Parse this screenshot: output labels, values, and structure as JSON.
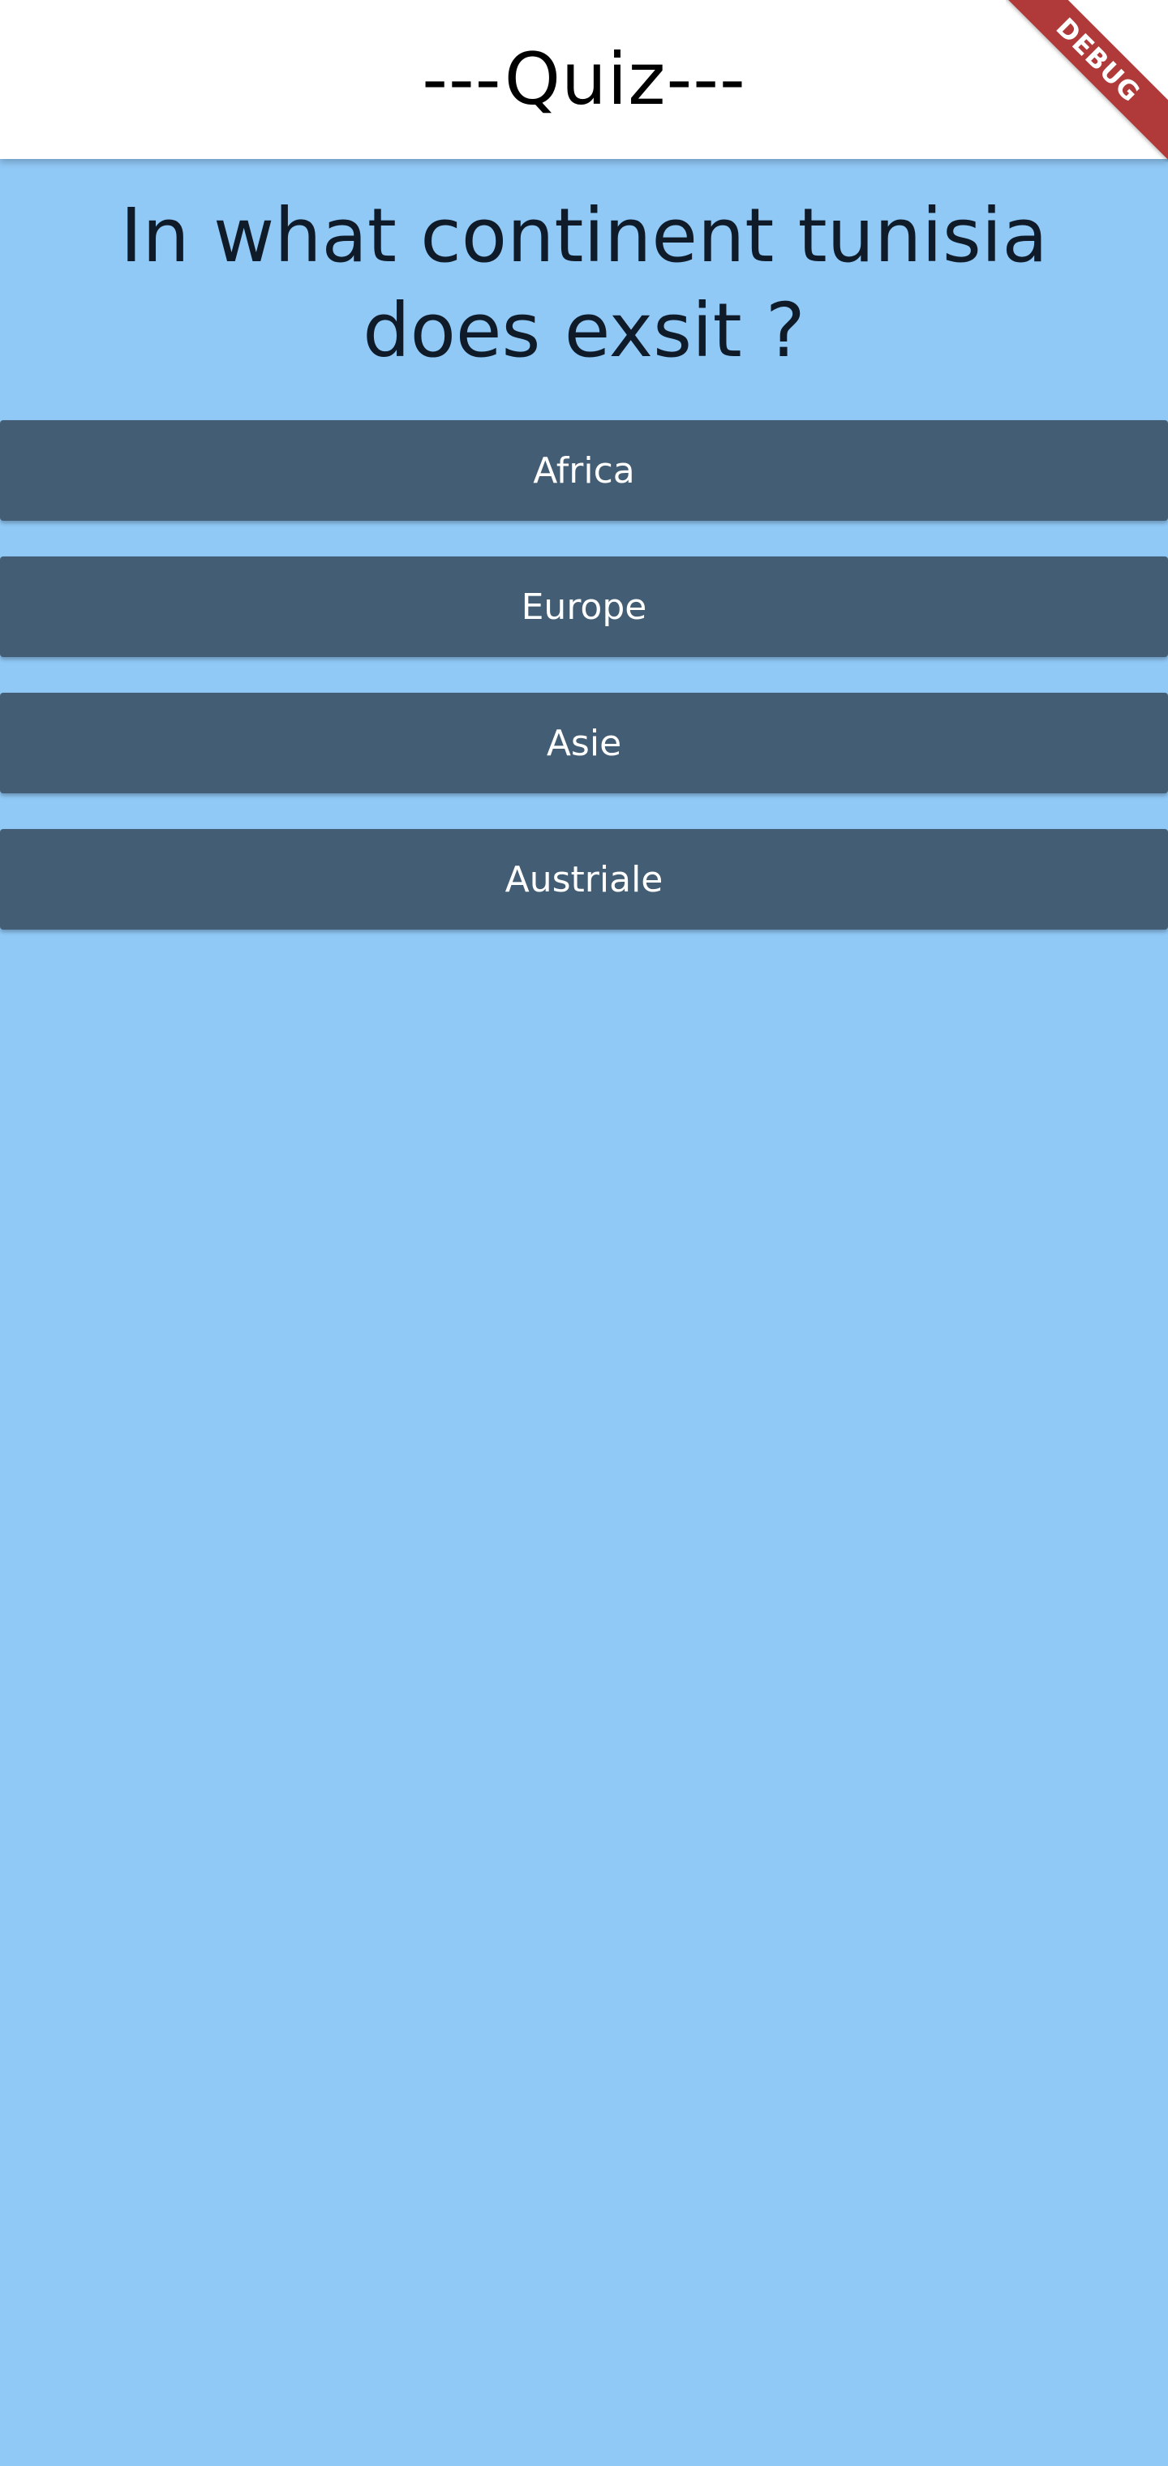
{
  "app_bar": {
    "title": "---Quiz---"
  },
  "quiz": {
    "question": "In what continent tunisia does exsit ?",
    "answers": [
      {
        "label": "Africa"
      },
      {
        "label": "Europe"
      },
      {
        "label": "Asie"
      },
      {
        "label": "Austriale"
      }
    ]
  },
  "debug_banner": {
    "label": "DEBUG"
  },
  "colors": {
    "app_bar_background": "#ffffff",
    "body_background": "#90c8f6",
    "button_background": "#435e74",
    "button_text": "#ffffff",
    "question_text": "#0f1b29",
    "debug_banner": "#b03a3a"
  }
}
